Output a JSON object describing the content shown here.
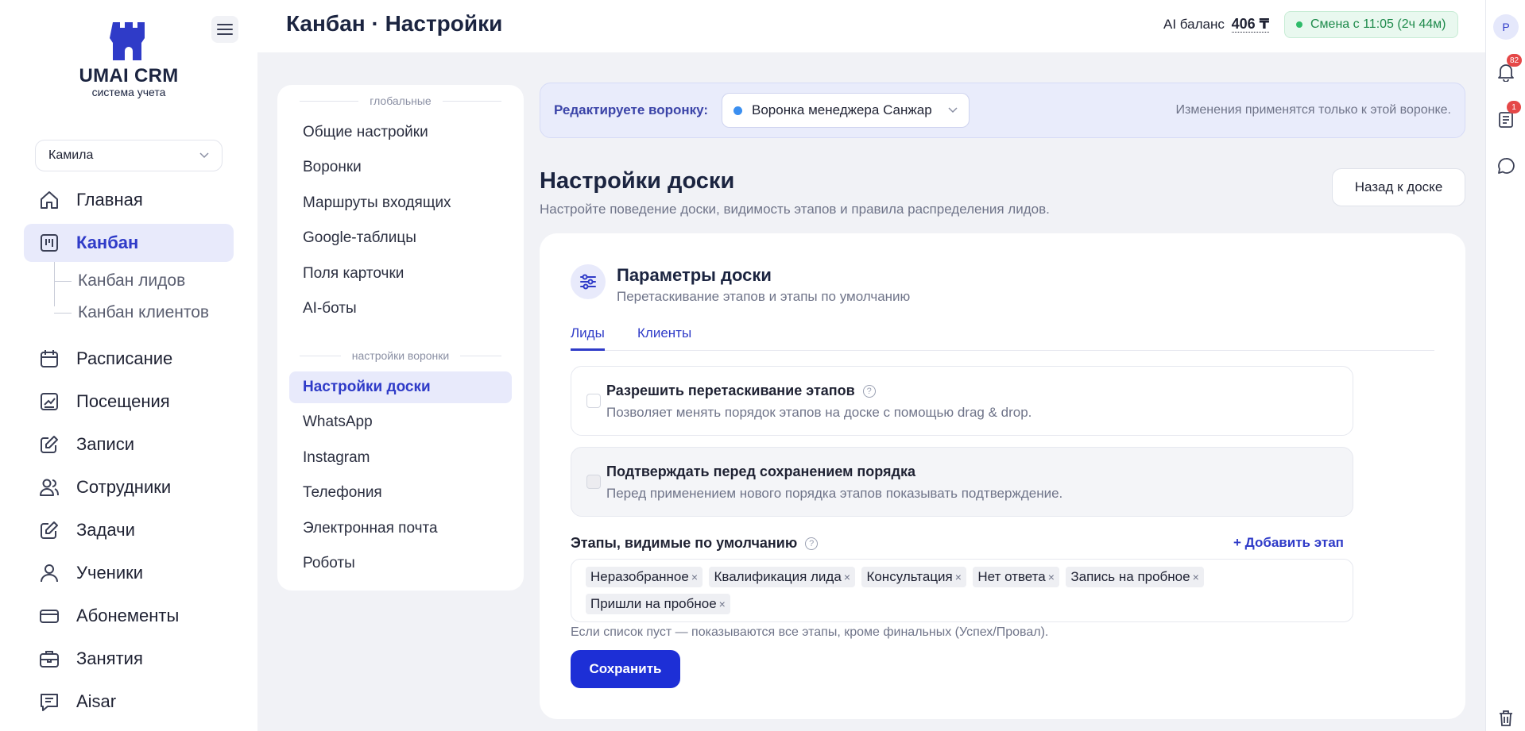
{
  "sidebar": {
    "brand": "UMAI CRM",
    "tagline": "система учета",
    "user": "Камила",
    "nav": [
      {
        "label": "Главная",
        "icon": "home-icon"
      },
      {
        "label": "Канбан",
        "icon": "kanban-icon"
      },
      {
        "label": "Расписание",
        "icon": "calendar-icon"
      },
      {
        "label": "Посещения",
        "icon": "chart-icon"
      },
      {
        "label": "Записи",
        "icon": "edit-icon"
      },
      {
        "label": "Сотрудники",
        "icon": "users-icon"
      },
      {
        "label": "Задачи",
        "icon": "task-icon"
      },
      {
        "label": "Ученики",
        "icon": "user-icon"
      },
      {
        "label": "Абонементы",
        "icon": "card-icon"
      },
      {
        "label": "Занятия",
        "icon": "briefcase-icon"
      },
      {
        "label": "Aisar",
        "icon": "message-icon"
      }
    ],
    "kanban_sub": [
      "Канбан лидов",
      "Канбан клиентов"
    ]
  },
  "header": {
    "title": "Канбан · Настройки",
    "ai_label": "AI баланс",
    "ai_amount": "406 ₸",
    "shift": "Смена с 11:05 (2ч 44м)"
  },
  "rail": {
    "avatar": "P",
    "notifications_count": "82",
    "docs_count": "1"
  },
  "settings_nav": {
    "global_label": "глобальные",
    "global_items": [
      "Общие настройки",
      "Воронки",
      "Маршруты входящих",
      "Google-таблицы",
      "Поля карточки",
      "AI-боты"
    ],
    "funnel_label": "настройки воронки",
    "funnel_items": [
      "Настройки доски",
      "WhatsApp",
      "Instagram",
      "Телефония",
      "Электронная почта",
      "Роботы"
    ]
  },
  "funnel_banner": {
    "label": "Редактируете воронку:",
    "selected": "Воронка менеджера Санжар",
    "note": "Изменения применятся только к этой воронке."
  },
  "board": {
    "title": "Настройки доски",
    "subtitle": "Настройте поведение доски, видимость этапов и правила распределения лидов.",
    "back_button": "Назад к доске"
  },
  "params": {
    "title": "Параметры доски",
    "subtitle": "Перетаскивание этапов и этапы по умолчанию",
    "tabs": [
      "Лиды",
      "Клиенты"
    ],
    "option1_title": "Разрешить перетаскивание этапов",
    "option1_desc": "Позволяет менять порядок этапов на доске с помощью drag & drop.",
    "option2_title": "Подтверждать перед сохранением порядка",
    "option2_desc": "Перед применением нового порядка этапов показывать подтверждение.",
    "stages_label": "Этапы, видимые по умолчанию",
    "add_stage": "+ Добавить этап",
    "stages": [
      "Неразобранное",
      "Квалификация лида",
      "Консультация",
      "Нет ответа",
      "Запись на пробное",
      "Пришли на пробное"
    ],
    "hint": "Если список пуст — показываются все этапы, кроме финальных (Успех/Провал).",
    "save": "Сохранить"
  },
  "colors": {
    "accent": "#2f3bc8",
    "primary_button": "#1d2fd6",
    "shift_green": "#1e8a4b"
  }
}
